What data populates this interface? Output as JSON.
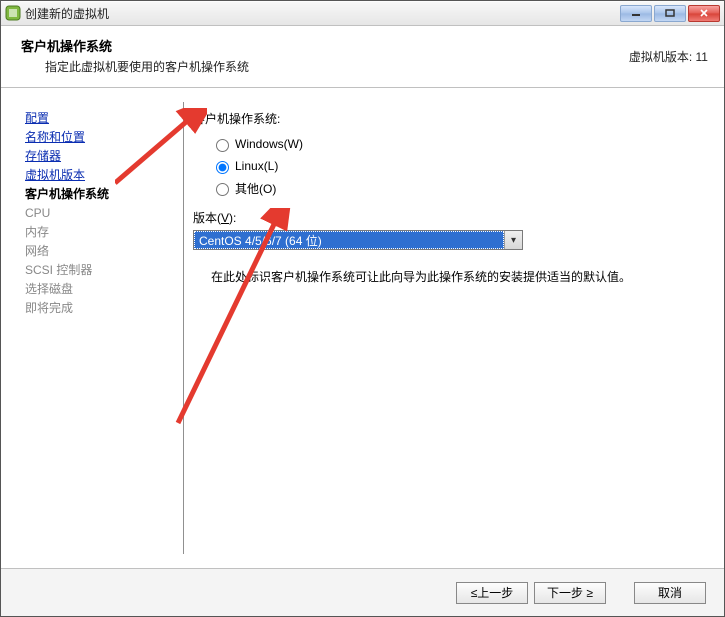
{
  "window": {
    "title": "创建新的虚拟机"
  },
  "header": {
    "title": "客户机操作系统",
    "subtitle": "指定此虚拟机要使用的客户机操作系统",
    "version_label": "虚拟机版本: 11"
  },
  "sidebar": {
    "items": [
      {
        "label": "配置",
        "state": "link"
      },
      {
        "label": "名称和位置",
        "state": "link"
      },
      {
        "label": "存储器",
        "state": "link"
      },
      {
        "label": "虚拟机版本",
        "state": "link"
      },
      {
        "label": "客户机操作系统",
        "state": "current"
      },
      {
        "label": "CPU",
        "state": "future"
      },
      {
        "label": "内存",
        "state": "future"
      },
      {
        "label": "网络",
        "state": "future"
      },
      {
        "label": "SCSI 控制器",
        "state": "future"
      },
      {
        "label": "选择磁盘",
        "state": "future"
      },
      {
        "label": "即将完成",
        "state": "future"
      }
    ]
  },
  "main": {
    "os_label": "客户机操作系统:",
    "radios": {
      "windows": "Windows(W)",
      "linux": "Linux(L)",
      "other": "其他(O)"
    },
    "selected_radio": "linux",
    "version_label": "版本(V):",
    "version_value": "CentOS 4/5/6/7 (64 位)",
    "hint": "在此处标识客户机操作系统可让此向导为此操作系统的安装提供适当的默认值。"
  },
  "footer": {
    "back": "≤上一步",
    "next": "下一步 ≥",
    "cancel": "取消"
  },
  "colors": {
    "accent": "#2f6fd0",
    "annotation": "#e43a2f"
  }
}
